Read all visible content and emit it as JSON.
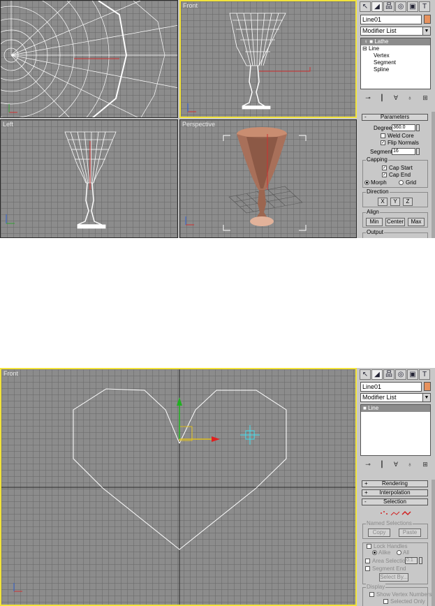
{
  "top_screenshot": {
    "viewports": {
      "front_label": "Front",
      "left_label": "Left",
      "perspective_label": "Perspective"
    },
    "command_panel": {
      "object_name": "Line01",
      "object_color": "#e7925e",
      "modifier_list": "Modifier List",
      "stack": [
        {
          "label": "Lathe",
          "selected": true
        },
        {
          "label": "Line",
          "selected": false
        },
        {
          "label": "Vertex",
          "selected": false
        },
        {
          "label": "Segment",
          "selected": false
        },
        {
          "label": "Spline",
          "selected": false
        }
      ],
      "rollout_title": "Parameters",
      "degrees_label": "Degrees:",
      "degrees_value": "360.0",
      "weld_core_label": "Weld Core",
      "weld_core_checked": false,
      "flip_normals_label": "Flip Normals",
      "flip_normals_checked": true,
      "segments_label": "Segments:",
      "segments_value": "16",
      "capping": {
        "title": "Capping",
        "cap_start_label": "Cap Start",
        "cap_start_checked": true,
        "cap_end_label": "Cap End",
        "cap_end_checked": true,
        "morph_label": "Morph",
        "grid_label": "Grid",
        "selected": "Morph"
      },
      "direction": {
        "title": "Direction",
        "buttons": [
          "X",
          "Y",
          "Z"
        ]
      },
      "align": {
        "title": "Align",
        "buttons": [
          "Min",
          "Center",
          "Max"
        ]
      },
      "output_title": "Output"
    }
  },
  "bottom_screenshot": {
    "viewports": {
      "front_label": "Front"
    },
    "command_panel": {
      "object_name": "Line01",
      "object_color": "#e7925e",
      "modifier_list": "Modifier List",
      "stack": [
        {
          "label": "Line",
          "selected": true
        }
      ],
      "rollouts": [
        {
          "sign": "+",
          "label": "Rendering"
        },
        {
          "sign": "+",
          "label": "Interpolation"
        },
        {
          "sign": "-",
          "label": "Selection"
        }
      ],
      "named_selections": {
        "title": "Named Selections",
        "copy": "Copy",
        "paste": "Paste"
      },
      "lock_handles_label": "Lock Handles",
      "alike_label": "Alike",
      "all_label": "All",
      "area_selection_label": "Area Selection:",
      "area_selection_value": "0.1",
      "segment_end_label": "Segment End",
      "select_by_label": "Select By...",
      "display": {
        "title": "Display",
        "show_vertex_numbers": "Show Vertex Numbers",
        "selected_only": "Selected Only"
      }
    }
  },
  "colors": {
    "active_viewport_border": "#f2e33a",
    "viewport_bg": "#8c8c8c",
    "panel_bg": "#c8c8c8",
    "object_orange": "#e7925e"
  }
}
